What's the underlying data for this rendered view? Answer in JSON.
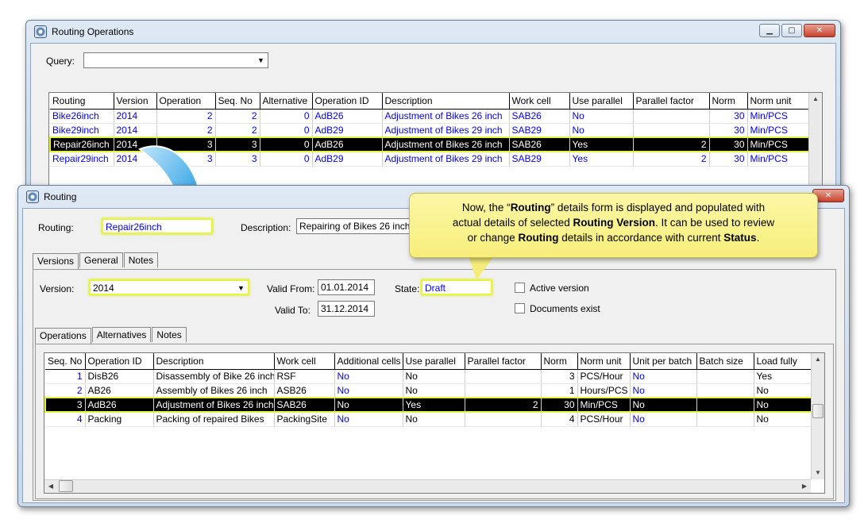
{
  "routing_operations": {
    "title": "Routing Operations",
    "query_label": "Query:",
    "query_value": "",
    "columns": [
      "Routing",
      "Version",
      "Operation",
      "Seq. No",
      "Alternative",
      "Operation ID",
      "Description",
      "Work cell",
      "Use parallel",
      "Parallel factor",
      "Norm",
      "Norm unit"
    ],
    "rows": [
      [
        "Bike26inch",
        "2014",
        "2",
        "2",
        "0",
        "AdB26",
        "Adjustment of Bikes 26 inch",
        "SAB26",
        "No",
        "",
        "30",
        "Min/PCS"
      ],
      [
        "Bike29inch",
        "2014",
        "2",
        "2",
        "0",
        "AdB29",
        "Adjustment of Bikes 29 inch",
        "SAB29",
        "No",
        "",
        "30",
        "Min/PCS"
      ],
      [
        "Repair26inch",
        "2014",
        "3",
        "3",
        "0",
        "AdB26",
        "Adjustment of Bikes 26 inch",
        "SAB26",
        "Yes",
        "2",
        "30",
        "Min/PCS"
      ],
      [
        "Repair29inch",
        "2014",
        "3",
        "3",
        "0",
        "AdB29",
        "Adjustment of Bikes 29 inch",
        "SAB29",
        "Yes",
        "2",
        "30",
        "Min/PCS"
      ]
    ],
    "selected_row": 2
  },
  "routing": {
    "title": "Routing",
    "routing_label": "Routing:",
    "routing_value": "Repair26inch",
    "description_label": "Description:",
    "description_value": "Repairing of Bikes 26 inch",
    "tabs": [
      "Versions",
      "General",
      "Notes"
    ],
    "version_label": "Version:",
    "version_value": "2014",
    "valid_from_label": "Valid From:",
    "valid_from_value": "01.01.2014",
    "valid_to_label": "Valid To:",
    "valid_to_value": "31.12.2014",
    "state_label": "State:",
    "state_value": "Draft",
    "active_version_label": "Active version",
    "documents_exist_label": "Documents exist",
    "subtabs": [
      "Operations",
      "Alternatives",
      "Notes"
    ],
    "columns": [
      "Seq. No",
      "Operation ID",
      "Description",
      "Work cell",
      "Additional cells",
      "Use parallel",
      "Parallel factor",
      "Norm",
      "Norm unit",
      "Unit per batch",
      "Batch size",
      "Load fully"
    ],
    "rows": [
      [
        "1",
        "DisB26",
        "Disassembly of Bike 26 inch",
        "RSF",
        "No",
        "No",
        "",
        "3",
        "PCS/Hour",
        "No",
        "",
        "Yes"
      ],
      [
        "2",
        "AB26",
        "Assembly of Bikes 26 inch",
        "ASB26",
        "No",
        "No",
        "",
        "1",
        "Hours/PCS",
        "No",
        "",
        "No"
      ],
      [
        "3",
        "AdB26",
        "Adjustment of Bikes 26 inch",
        "SAB26",
        "No",
        "Yes",
        "2",
        "30",
        "Min/PCS",
        "No",
        "",
        "No"
      ],
      [
        "4",
        "Packing",
        "Packing of repaired Bikes",
        "PackingSite",
        "No",
        "No",
        "",
        "4",
        "PCS/Hour",
        "No",
        "",
        "No"
      ]
    ],
    "selected_row": 2
  },
  "callout": {
    "l1a": "Now, the “",
    "l1b": "Routing",
    "l1c": "” details form is displayed and populated with",
    "l2a": "actual details of selected ",
    "l2b": "Routing Version",
    "l2c": ". It can be used to review",
    "l3a": "or change ",
    "l3b": "Routing",
    "l3c": " details in accordance with current ",
    "l3d": "Status",
    "l3e": "."
  },
  "colors": {
    "link_blue": "#0000ff",
    "highlight": "#e6f53a",
    "callout_bg": "#f7ee7b"
  }
}
